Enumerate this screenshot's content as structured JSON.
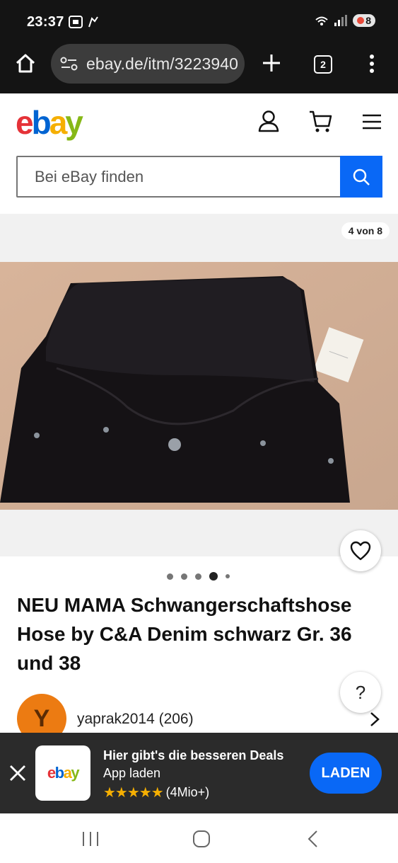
{
  "status_bar": {
    "time": "23:37",
    "network": "5",
    "battery": "8"
  },
  "browser": {
    "url": "ebay.de/itm/3223940",
    "tab_count": "2"
  },
  "ebay": {
    "logo": [
      "e",
      "b",
      "a",
      "y"
    ],
    "search_placeholder": "Bei eBay finden"
  },
  "gallery": {
    "counter": "4 von 8",
    "current_index": 4,
    "image_count": 8
  },
  "listing": {
    "title": "NEU MAMA Schwangerschaftshose Hose by C&A Denim schwarz Gr. 36 und 38",
    "seller_initial": "Y",
    "seller": "yaprak2014 (206)"
  },
  "app_banner": {
    "headline": "Hier gibt's die besseren Deals",
    "subline": "App laden",
    "stars": "★★★★★",
    "rating_count": "(4Mio+)",
    "button": "LADEN"
  },
  "colors": {
    "accent": "#0968f6",
    "avatar": "#ec7b12",
    "banner_bg": "#2b2b2b",
    "star": "#f5af02"
  }
}
